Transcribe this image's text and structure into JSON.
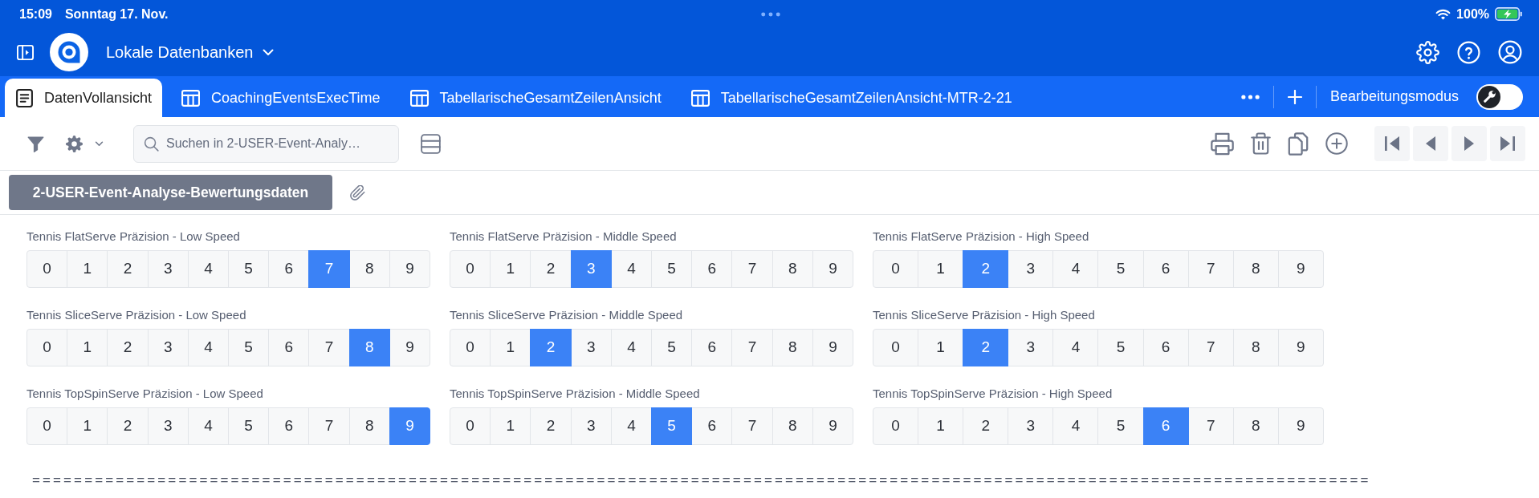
{
  "status_bar": {
    "time": "15:09",
    "date": "Sonntag 17. Nov.",
    "battery": "100%"
  },
  "header": {
    "title": "Lokale Datenbanken"
  },
  "tabs": [
    {
      "label": "DatenVollansicht",
      "kind": "document",
      "selected": true
    },
    {
      "label": "CoachingEventsExecTime",
      "kind": "table",
      "selected": false
    },
    {
      "label": "TabellarischeGesamtZeilenAnsicht",
      "kind": "table",
      "selected": false
    },
    {
      "label": "TabellarischeGesamtZeilenAnsicht-MTR-2-21",
      "kind": "table",
      "selected": false
    }
  ],
  "edit_mode": {
    "label": "Bearbeitungsmodus",
    "on": false
  },
  "toolbar": {
    "search": {
      "placeholder": "Suchen in 2-USER-Event-Analy…"
    }
  },
  "record": {
    "title": "2-USER-Event-Analyse-Bewertungsdaten"
  },
  "ratings": [
    {
      "label": "Tennis FlatServe Präzision - Low Speed",
      "options": [
        {
          "label": "0",
          "selected": false
        },
        {
          "label": "1",
          "selected": false
        },
        {
          "label": "2",
          "selected": false
        },
        {
          "label": "3",
          "selected": false
        },
        {
          "label": "4",
          "selected": false
        },
        {
          "label": "5",
          "selected": false
        },
        {
          "label": "6",
          "selected": false
        },
        {
          "label": "7",
          "selected": true
        },
        {
          "label": "8",
          "selected": false
        },
        {
          "label": "9",
          "selected": false
        }
      ]
    },
    {
      "label": "Tennis FlatServe Präzision - Middle Speed",
      "options": [
        {
          "label": "0",
          "selected": false
        },
        {
          "label": "1",
          "selected": false
        },
        {
          "label": "2",
          "selected": false
        },
        {
          "label": "3",
          "selected": true
        },
        {
          "label": "4",
          "selected": false
        },
        {
          "label": "5",
          "selected": false
        },
        {
          "label": "6",
          "selected": false
        },
        {
          "label": "7",
          "selected": false
        },
        {
          "label": "8",
          "selected": false
        },
        {
          "label": "9",
          "selected": false
        }
      ]
    },
    {
      "label": "Tennis FlatServe Präzision - High Speed",
      "options": [
        {
          "label": "0",
          "selected": false
        },
        {
          "label": "1",
          "selected": false
        },
        {
          "label": "2",
          "selected": true
        },
        {
          "label": "3",
          "selected": false
        },
        {
          "label": "4",
          "selected": false
        },
        {
          "label": "5",
          "selected": false
        },
        {
          "label": "6",
          "selected": false
        },
        {
          "label": "7",
          "selected": false
        },
        {
          "label": "8",
          "selected": false
        },
        {
          "label": "9",
          "selected": false
        }
      ]
    },
    {
      "label": "Tennis SliceServe Präzision - Low Speed",
      "options": [
        {
          "label": "0",
          "selected": false
        },
        {
          "label": "1",
          "selected": false
        },
        {
          "label": "2",
          "selected": false
        },
        {
          "label": "3",
          "selected": false
        },
        {
          "label": "4",
          "selected": false
        },
        {
          "label": "5",
          "selected": false
        },
        {
          "label": "6",
          "selected": false
        },
        {
          "label": "7",
          "selected": false
        },
        {
          "label": "8",
          "selected": true
        },
        {
          "label": "9",
          "selected": false
        }
      ]
    },
    {
      "label": "Tennis SliceServe Präzision - Middle Speed",
      "options": [
        {
          "label": "0",
          "selected": false
        },
        {
          "label": "1",
          "selected": false
        },
        {
          "label": "2",
          "selected": true
        },
        {
          "label": "3",
          "selected": false
        },
        {
          "label": "4",
          "selected": false
        },
        {
          "label": "5",
          "selected": false
        },
        {
          "label": "6",
          "selected": false
        },
        {
          "label": "7",
          "selected": false
        },
        {
          "label": "8",
          "selected": false
        },
        {
          "label": "9",
          "selected": false
        }
      ]
    },
    {
      "label": "Tennis SliceServe Präzision - High Speed",
      "options": [
        {
          "label": "0",
          "selected": false
        },
        {
          "label": "1",
          "selected": false
        },
        {
          "label": "2",
          "selected": true
        },
        {
          "label": "3",
          "selected": false
        },
        {
          "label": "4",
          "selected": false
        },
        {
          "label": "5",
          "selected": false
        },
        {
          "label": "6",
          "selected": false
        },
        {
          "label": "7",
          "selected": false
        },
        {
          "label": "8",
          "selected": false
        },
        {
          "label": "9",
          "selected": false
        }
      ]
    },
    {
      "label": "Tennis TopSpinServe Präzision - Low Speed",
      "options": [
        {
          "label": "0",
          "selected": false
        },
        {
          "label": "1",
          "selected": false
        },
        {
          "label": "2",
          "selected": false
        },
        {
          "label": "3",
          "selected": false
        },
        {
          "label": "4",
          "selected": false
        },
        {
          "label": "5",
          "selected": false
        },
        {
          "label": "6",
          "selected": false
        },
        {
          "label": "7",
          "selected": false
        },
        {
          "label": "8",
          "selected": false
        },
        {
          "label": "9",
          "selected": true
        }
      ]
    },
    {
      "label": "Tennis TopSpinServe Präzision - Middle Speed",
      "options": [
        {
          "label": "0",
          "selected": false
        },
        {
          "label": "1",
          "selected": false
        },
        {
          "label": "2",
          "selected": false
        },
        {
          "label": "3",
          "selected": false
        },
        {
          "label": "4",
          "selected": false
        },
        {
          "label": "5",
          "selected": true
        },
        {
          "label": "6",
          "selected": false
        },
        {
          "label": "7",
          "selected": false
        },
        {
          "label": "8",
          "selected": false
        },
        {
          "label": "9",
          "selected": false
        }
      ]
    },
    {
      "label": "Tennis TopSpinServe Präzision - High Speed",
      "options": [
        {
          "label": "0",
          "selected": false
        },
        {
          "label": "1",
          "selected": false
        },
        {
          "label": "2",
          "selected": false
        },
        {
          "label": "3",
          "selected": false
        },
        {
          "label": "4",
          "selected": false
        },
        {
          "label": "5",
          "selected": false
        },
        {
          "label": "6",
          "selected": true
        },
        {
          "label": "7",
          "selected": false
        },
        {
          "label": "8",
          "selected": false
        },
        {
          "label": "9",
          "selected": false
        }
      ]
    }
  ],
  "separator": "================================================================================================================================"
}
